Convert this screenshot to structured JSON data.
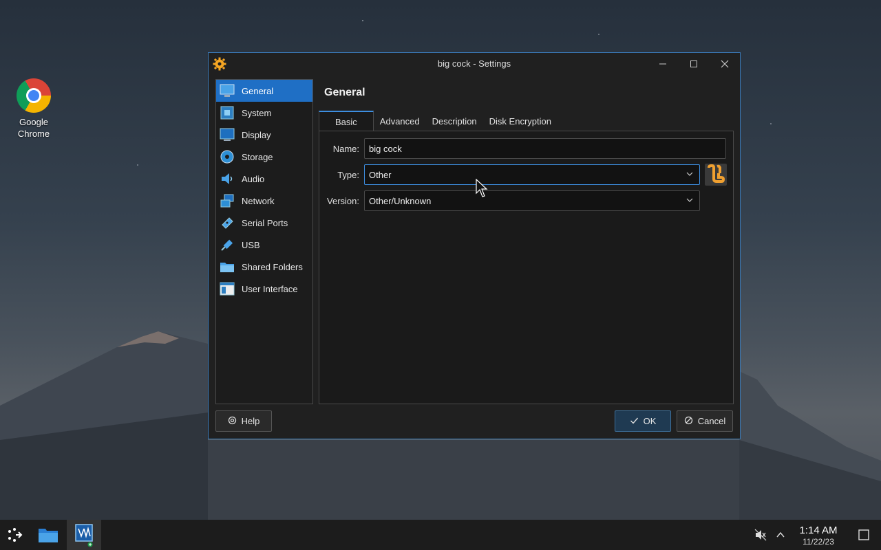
{
  "desktop": {
    "icons": [
      {
        "label": "Google Chrome",
        "icon": "chrome-icon"
      }
    ]
  },
  "window": {
    "title": "big cock - Settings",
    "app_icon": "gear-icon",
    "controls": {
      "minimize": "minimize-icon",
      "maximize": "maximize-icon",
      "close": "close-icon"
    }
  },
  "sidebar": {
    "items": [
      {
        "label": "General",
        "icon": "monitor-icon",
        "active": true
      },
      {
        "label": "System",
        "icon": "chip-icon"
      },
      {
        "label": "Display",
        "icon": "display-icon"
      },
      {
        "label": "Storage",
        "icon": "disk-icon"
      },
      {
        "label": "Audio",
        "icon": "speaker-icon"
      },
      {
        "label": "Network",
        "icon": "network-icon"
      },
      {
        "label": "Serial Ports",
        "icon": "serial-port-icon"
      },
      {
        "label": "USB",
        "icon": "usb-icon"
      },
      {
        "label": "Shared Folders",
        "icon": "folder-icon"
      },
      {
        "label": "User Interface",
        "icon": "window-layout-icon"
      }
    ]
  },
  "content": {
    "title": "General",
    "tabs": [
      {
        "label": "Basic",
        "active": true
      },
      {
        "label": "Advanced"
      },
      {
        "label": "Description"
      },
      {
        "label": "Disk Encryption"
      }
    ],
    "form": {
      "name_label": "Name:",
      "name_value": "big cock",
      "type_label": "Type:",
      "type_value": "Other",
      "version_label": "Version:",
      "version_value": "Other/Unknown"
    }
  },
  "buttons": {
    "help": "Help",
    "ok": "OK",
    "cancel": "Cancel"
  },
  "taskbar": {
    "time": "1:14 AM",
    "date": "11/22/23"
  },
  "colors": {
    "accent": "#1f6fc5",
    "focus": "#3d8ee0",
    "window_bg": "#202020"
  }
}
